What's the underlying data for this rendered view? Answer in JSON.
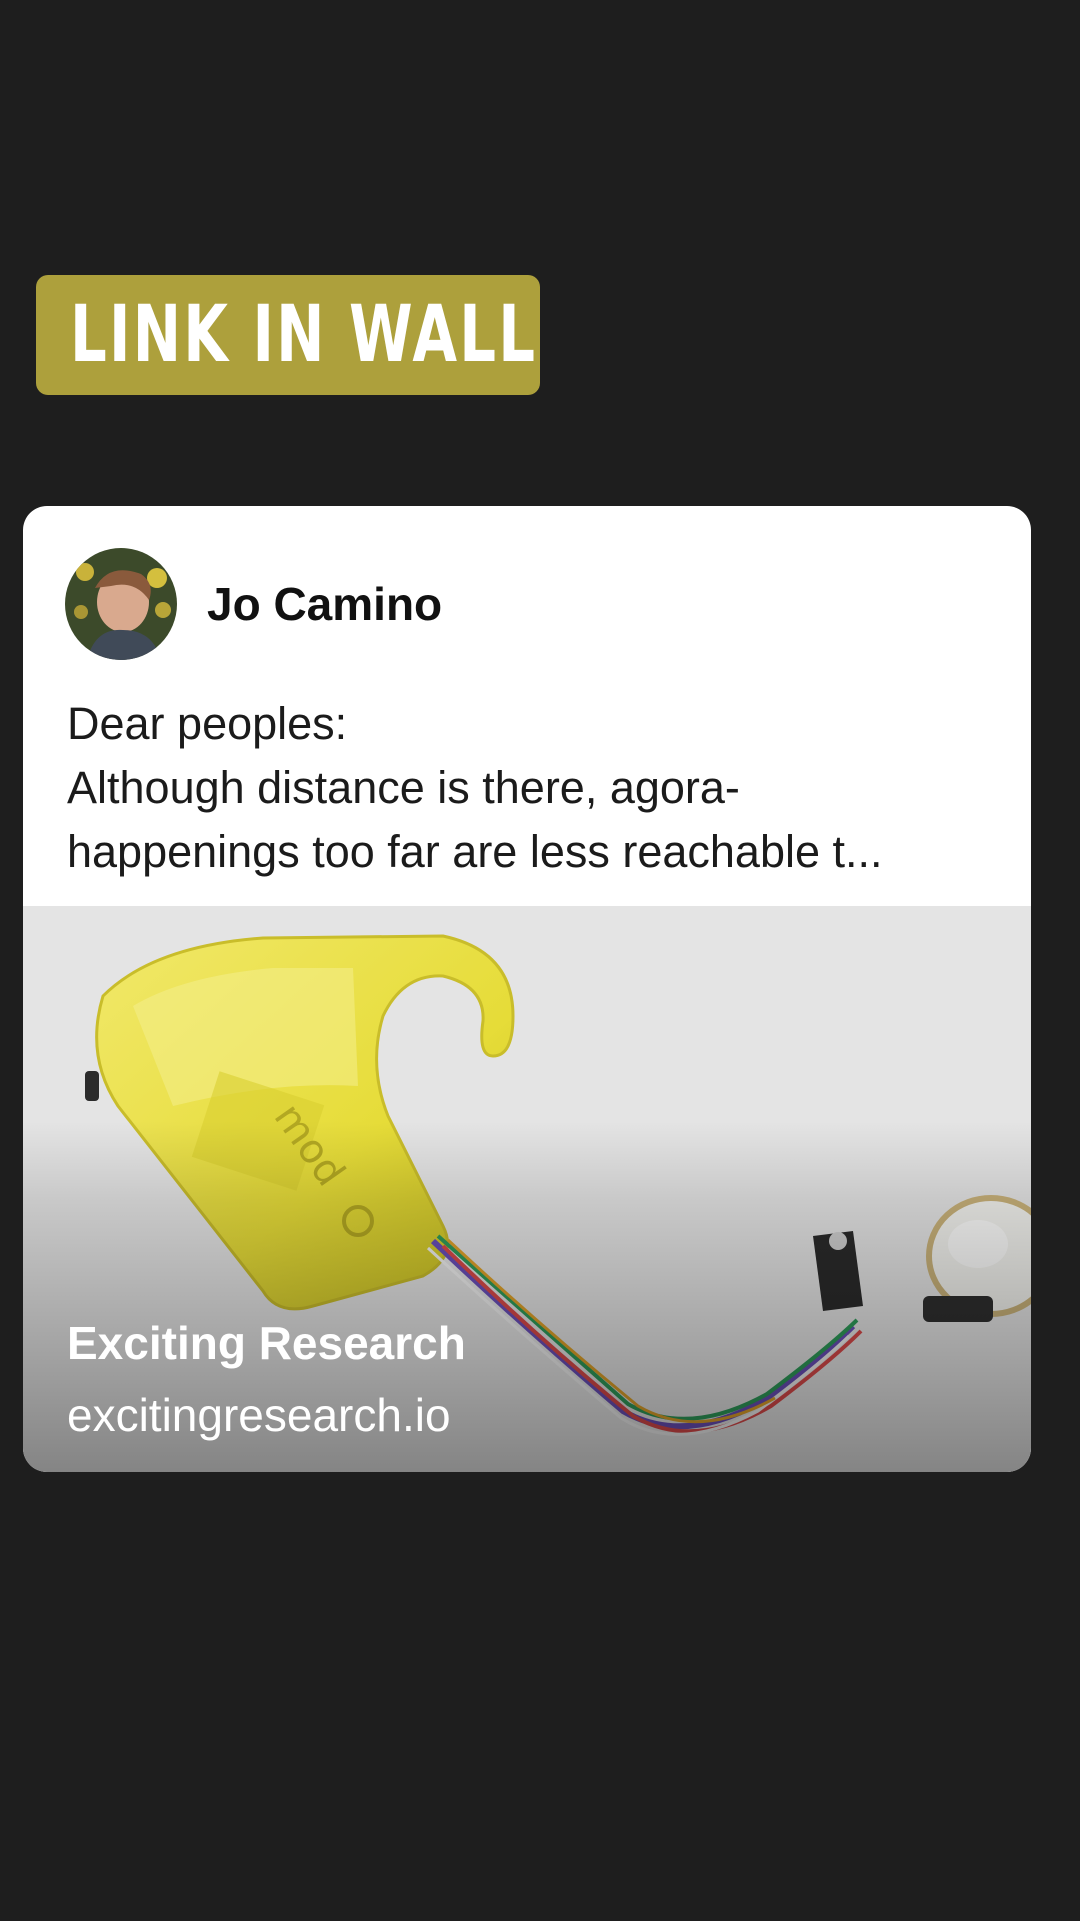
{
  "banner": {
    "label": "LINK IN WALL",
    "color": "#ada03c"
  },
  "post": {
    "author": {
      "name": "Jo Camino",
      "avatar_icon": "user-avatar-photo"
    },
    "text_lines": [
      "Dear peoples:",
      "Although distance is there, agora-",
      "happenings too far are less reachable t..."
    ],
    "link_preview": {
      "image_icon": "yellow-wearable-sensor-device-photo",
      "title": "Exciting Research",
      "domain": "excitingresearch.io"
    }
  },
  "colors": {
    "background": "#1e1e1e",
    "card": "#ffffff",
    "banner": "#ada03c"
  }
}
